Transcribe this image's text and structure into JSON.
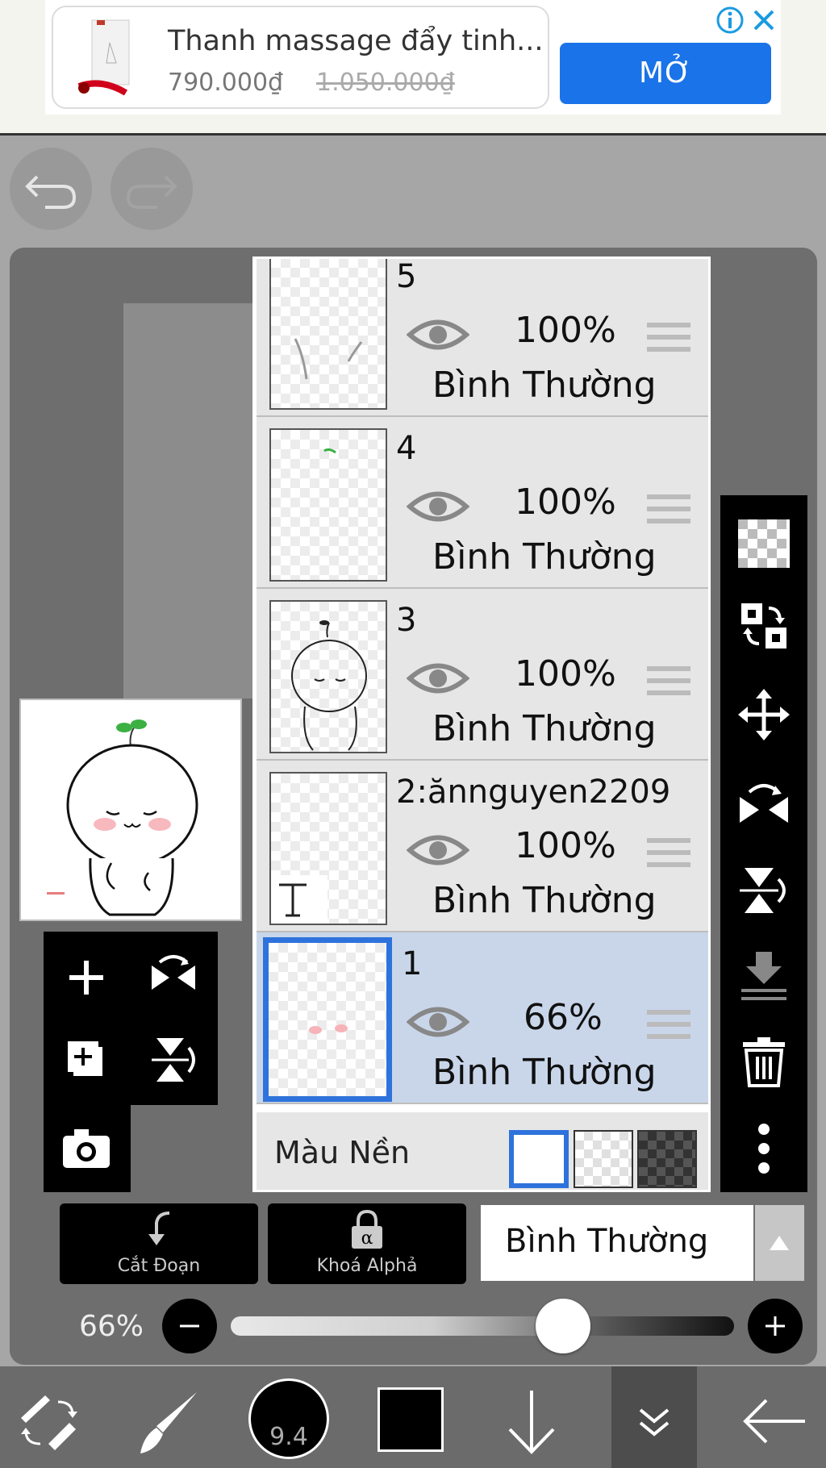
{
  "ad": {
    "title": "Thanh massage đẩy tinh...",
    "price": "790.000₫",
    "old_price": "1.050.000₫",
    "open_label": "MỞ",
    "accent_color": "#1a73e8"
  },
  "layers": [
    {
      "name": "5",
      "opacity": "100%",
      "blend": "Bình Thường",
      "selected": false
    },
    {
      "name": "4",
      "opacity": "100%",
      "blend": "Bình Thường",
      "selected": false
    },
    {
      "name": "3",
      "opacity": "100%",
      "blend": "Bình Thường",
      "selected": false
    },
    {
      "name": "2:ănnguyen2209",
      "opacity": "100%",
      "blend": "Bình Thường",
      "selected": false
    },
    {
      "name": "1",
      "opacity": "66%",
      "blend": "Bình Thường",
      "selected": true
    }
  ],
  "background": {
    "label": "Màu Nền",
    "options": [
      "white",
      "transparent",
      "dark"
    ],
    "selected": "white"
  },
  "controls": {
    "clip_label": "Cắt Đoạn",
    "alpha_lock_label": "Khoá Alphả",
    "blend_mode": "Bình Thường",
    "opacity_label": "66%",
    "opacity_value": 0.66
  },
  "toolbar": {
    "brush_size": "9.4",
    "color": "#000000"
  },
  "selection_color": "#2e73dc"
}
